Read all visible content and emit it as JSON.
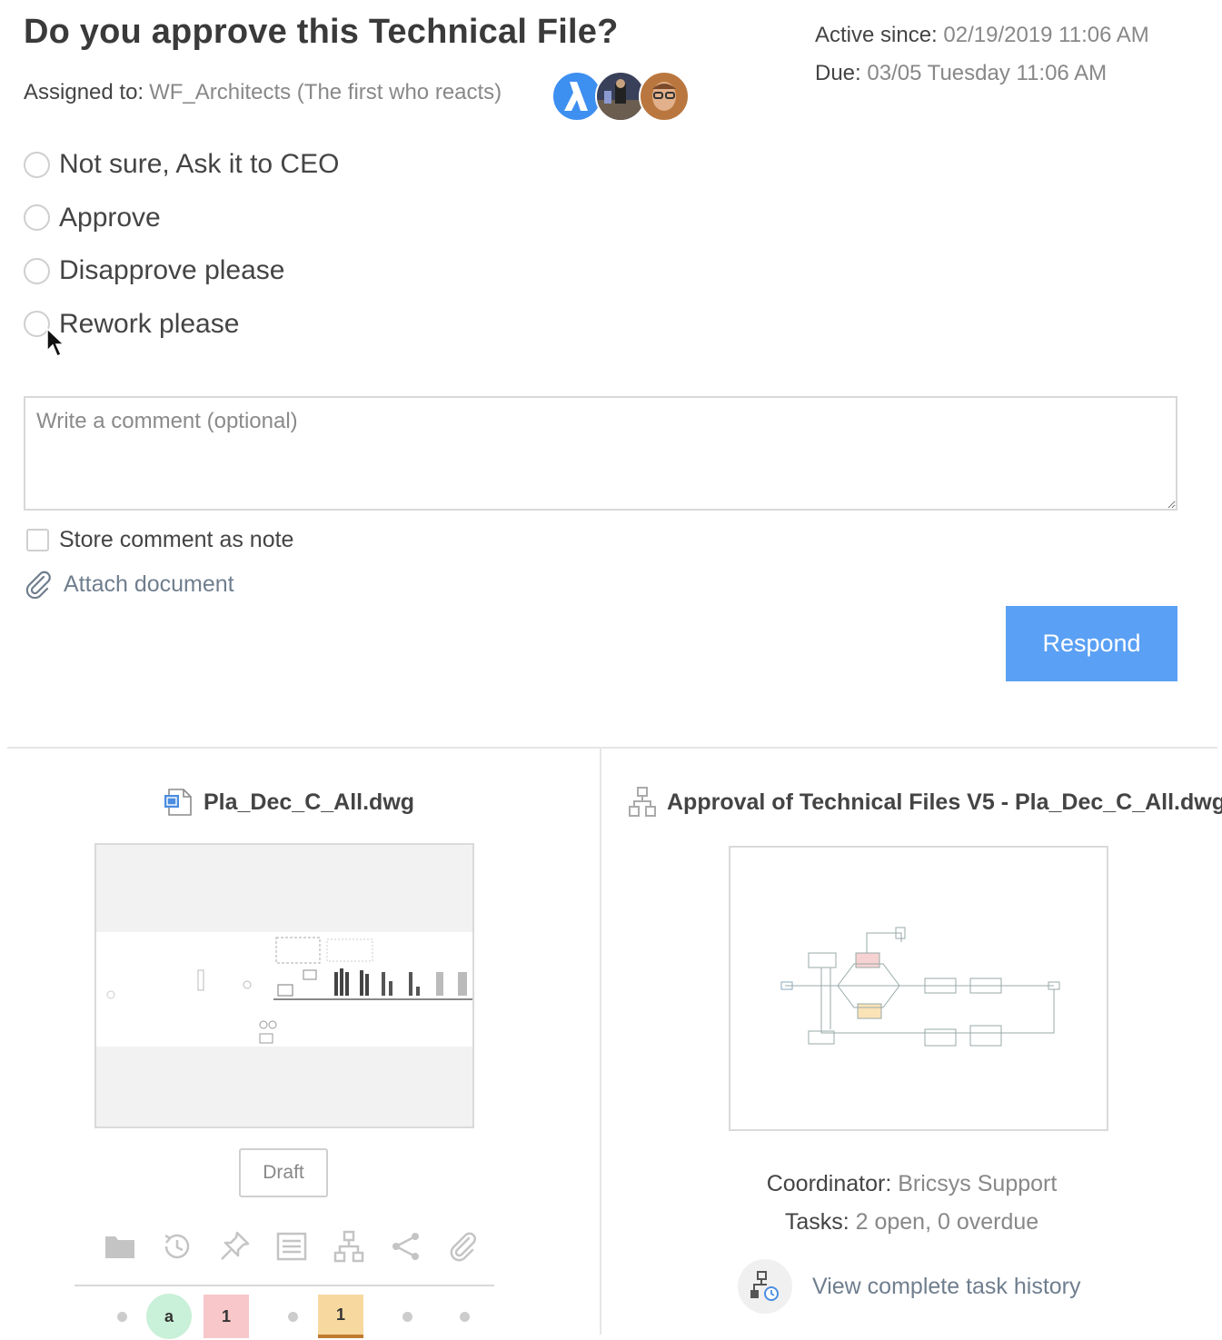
{
  "task": {
    "question": "Do you approve this Technical File?",
    "assigned_label": "Assigned to:",
    "assigned_value": "WF_Architects (The first who reacts)",
    "active_label": "Active since:",
    "active_value": "02/19/2019 11:06 AM",
    "due_label": "Due:",
    "due_value": "03/05 Tuesday 11:06 AM",
    "options": [
      "Not sure, Ask it to CEO",
      "Approve",
      "Disapprove please",
      "Rework please"
    ],
    "comment_placeholder": "Write a comment (optional)",
    "store_comment_label": "Store comment as note",
    "attach_label": "Attach document",
    "respond_label": "Respond"
  },
  "document": {
    "filename": "Pla_Dec_C_All.dwg",
    "status_button": "Draft",
    "toolbar_icons": [
      "folder-icon",
      "history-icon",
      "pin-icon",
      "document-icon",
      "workflow-icon",
      "share-icon",
      "attachment-icon"
    ],
    "status_badges": [
      {
        "type": "dot"
      },
      {
        "type": "circle",
        "label": "a",
        "color": "#c9f0d8"
      },
      {
        "type": "square",
        "label": "1",
        "color": "#f7c7c9"
      },
      {
        "type": "dot"
      },
      {
        "type": "square",
        "label": "1",
        "color": "#f7d9a0"
      },
      {
        "type": "dot"
      },
      {
        "type": "dot"
      }
    ]
  },
  "workflow": {
    "title": "Approval of Technical Files V5 - Pla_Dec_C_All.dwg",
    "coordinator_label": "Coordinator:",
    "coordinator_value": "Bricsys Support",
    "tasks_label": "Tasks:",
    "tasks_value": "2 open, 0 overdue",
    "history_link": "View complete task history"
  },
  "colors": {
    "accent": "#5aa0f4",
    "link": "#6f7e8e",
    "muted": "#888888"
  }
}
